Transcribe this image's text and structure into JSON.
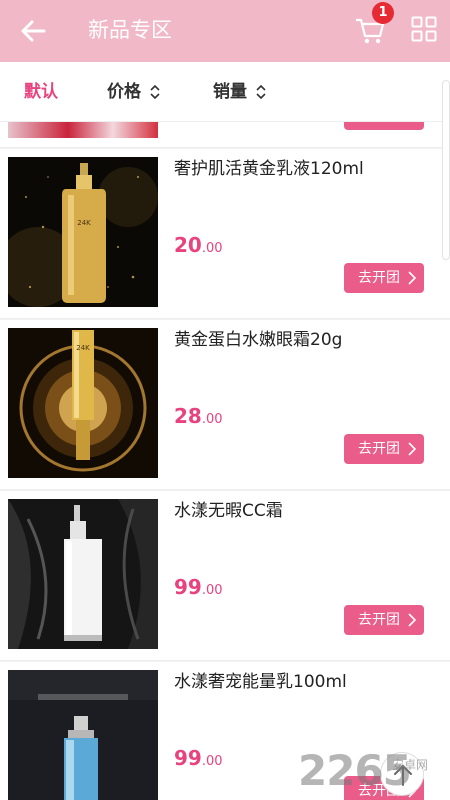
{
  "header": {
    "title": "新品专区",
    "cart_badge": "1"
  },
  "sortbar": {
    "default_label": "默认",
    "price_label": "价格",
    "sales_label": "销量"
  },
  "products": [
    {
      "name": "奢护肌活黄金乳液120ml",
      "price_int": "20",
      "price_dec": ".00",
      "button": "去开团"
    },
    {
      "name": "黄金蛋白水嫩眼霜20g",
      "price_int": "28",
      "price_dec": ".00",
      "button": "去开团"
    },
    {
      "name": "水漾无暇CC霜",
      "price_int": "99",
      "price_dec": ".00",
      "button": "去开团"
    },
    {
      "name": "水漾奢宠能量乳100ml",
      "price_int": "99",
      "price_dec": ".00",
      "button": "去开团"
    }
  ],
  "watermark": {
    "main": "2265",
    "sub": "安卓网"
  },
  "colors": {
    "header": "#f1b9c8",
    "accent": "#e8427f",
    "button": "#ea5c8a"
  }
}
